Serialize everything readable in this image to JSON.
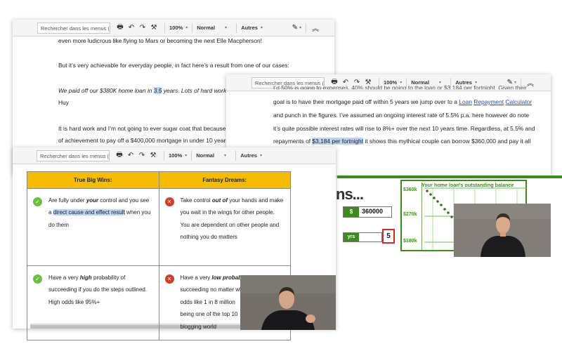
{
  "toolbar": {
    "search_placeholder": "Rechercher dans les menus (A",
    "zoom": "100%",
    "style": "Normal",
    "more": "Autres"
  },
  "doc1": {
    "lines": [
      "even more ludicrous like flying to Mars or becoming the next Elle Macpherson!",
      "But it’s very achievable for everyday people, in fact here’s a result from one of our cases:",
      "We paid off our $380K home loan in 3.5 years. Lots of hard work",
      "Huy",
      "It is hard work and I’m not going to ever sugar coat that because it",
      "of achievement to pay off a $400,000 mortgage in under 10 years"
    ],
    "quote_pre": "We paid off our $380K home loan in ",
    "quote_hl": "3.5",
    "quote_post": " years. Lots of hard work"
  },
  "doc2": {
    "line1": "I’d 50% is going to expenses, 40% should be going to the loan or $3,184 per fortnight. Given their",
    "line2_pre": "goal is to have their mortgage paid off within 5 years we jump over to a ",
    "link1": "Loan",
    "link2": "Repayment",
    "link3": "Calculator",
    "line3": "and punch in the figures. I’ve assumed an ongoing interest rate of 5.5% p.a. here however do note",
    "line4": "it’s quite possible interest rates will rise to 8%+ over the next 10 years time. Regardless, at 5.5% and",
    "line5_pre": "repayments of ",
    "line5_hl": "$3,184 per fortnight",
    "line5_post": " it shows this mythical couple can borrow $360,000 and pay it all"
  },
  "table": {
    "col1_header": "True Big Wins:",
    "col2_header": "Fantasy Dreams:",
    "r1c1_a": "Are fully under ",
    "r1c1_b": "your",
    "r1c1_c": " control and you see",
    "r1c1_d": "a ",
    "r1c1_hl": "direct cause and effect result",
    "r1c1_e": " when you",
    "r1c1_f": "do them",
    "r1c2_a": "Take control ",
    "r1c2_b": "out of",
    "r1c2_c": " your hands and make",
    "r1c2_d": "you wait in the wings for other people.",
    "r1c2_e": "You are dependent on other people and",
    "r1c2_f": "nothing you do matters",
    "r2c1_a": "Have a very ",
    "r2c1_b": "high",
    "r2c1_c": " probability of",
    "r2c1_d": "succeeding if you do the steps outlined.",
    "r2c1_e": "High odds like 95%+",
    "r2c2_a": "Have a very ",
    "r2c2_b": "low probability",
    "r2c2_c": " of",
    "r2c2_d": "succeeding no matter what you do. Low",
    "r2c2_e": "odds like 1 in 8 million",
    "r2c2_f": "being one of the top 10",
    "r2c2_g": "blogging world"
  },
  "calculator": {
    "heading": "ns...",
    "currency_symbol": "$",
    "loan_amount": "360000",
    "years_label": "yrs",
    "years_value": "5",
    "chart_title": "Your home loan's outstanding balance",
    "y_ticks": [
      "$360k",
      "$270k",
      "$180k"
    ]
  }
}
